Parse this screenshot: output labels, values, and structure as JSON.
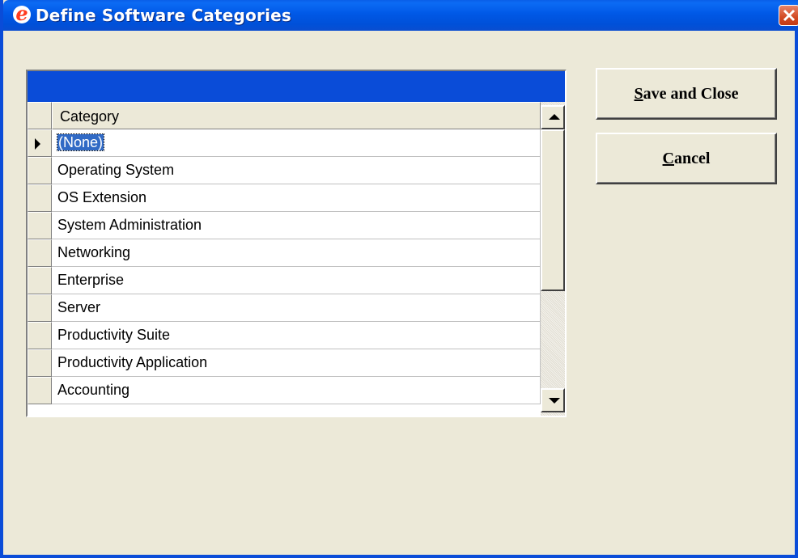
{
  "window": {
    "title": "Define Software Categories",
    "icon": "e-logo-icon",
    "accent": "#0a4cd8"
  },
  "grid": {
    "column_header": "Category",
    "selected_row": 0,
    "rows": [
      "(None)",
      "Operating System",
      "OS Extension",
      "System Administration",
      "Networking",
      "Enterprise",
      "Server",
      "Productivity Suite",
      "Productivity Application",
      "Accounting"
    ]
  },
  "buttons": {
    "save_mnemonic": "S",
    "save_rest": "ave and Close",
    "cancel_mnemonic": "C",
    "cancel_rest": "ancel"
  }
}
